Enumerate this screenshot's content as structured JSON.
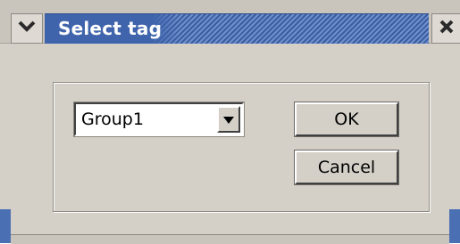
{
  "window": {
    "title": "Select tag",
    "title_bar_color": "#4a6fb3",
    "background_color": "#d4d0c8",
    "menu_icon": "chevron-down-icon",
    "close_icon": "close-icon"
  },
  "tag_select": {
    "value": "Group1",
    "arrow_icon": "triangle-down-icon"
  },
  "buttons": {
    "ok_label": "OK",
    "cancel_label": "Cancel"
  }
}
